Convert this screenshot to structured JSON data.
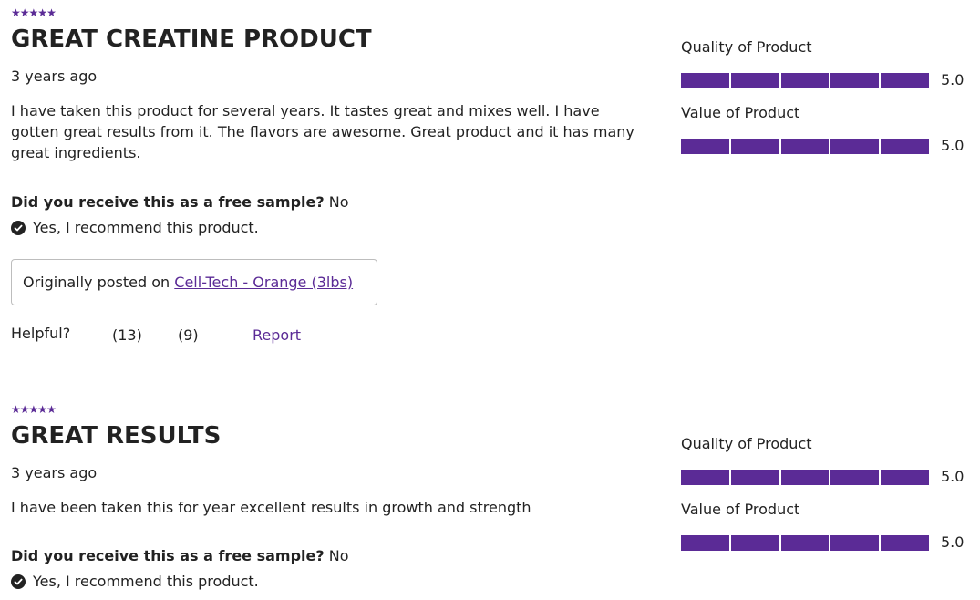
{
  "colors": {
    "accent": "#5b2b96",
    "text": "#222222",
    "bar_empty": "#e3e3e3",
    "border": "#bdbdbd"
  },
  "reviews": [
    {
      "stars": 5,
      "star_glyph": "★",
      "title": "GREAT CREATINE PRODUCT",
      "age": "3 years ago",
      "body": "I have taken this product for several years. It tastes great and mixes well. I have gotten great results from it. The flavors are awesome. Great product and it has many great ingredients.",
      "free_sample_question": "Did you receive this as a free sample?",
      "free_sample_answer": "No",
      "recommend_text": "Yes, I recommend this product.",
      "originally_posted_prefix": "Originally posted on",
      "originally_posted_link": "Cell-Tech - Orange (3lbs)",
      "helpful_label": "Helpful?",
      "helpful_yes": "(13)",
      "helpful_no": "(9)",
      "report_label": "Report",
      "ratings": [
        {
          "label": "Quality of Product",
          "value": 5.0,
          "value_text": "5.0"
        },
        {
          "label": "Value of Product",
          "value": 5.0,
          "value_text": "5.0"
        }
      ]
    },
    {
      "stars": 5,
      "star_glyph": "★",
      "title": "GREAT RESULTS",
      "age": "3 years ago",
      "body": "I have been taken this for year excellent results in growth and strength",
      "free_sample_question": "Did you receive this as a free sample?",
      "free_sample_answer": "No",
      "recommend_text": "Yes, I recommend this product.",
      "ratings": [
        {
          "label": "Quality of Product",
          "value": 5.0,
          "value_text": "5.0"
        },
        {
          "label": "Value of Product",
          "value": 5.0,
          "value_text": "5.0"
        }
      ]
    }
  ],
  "rating_max": 5
}
